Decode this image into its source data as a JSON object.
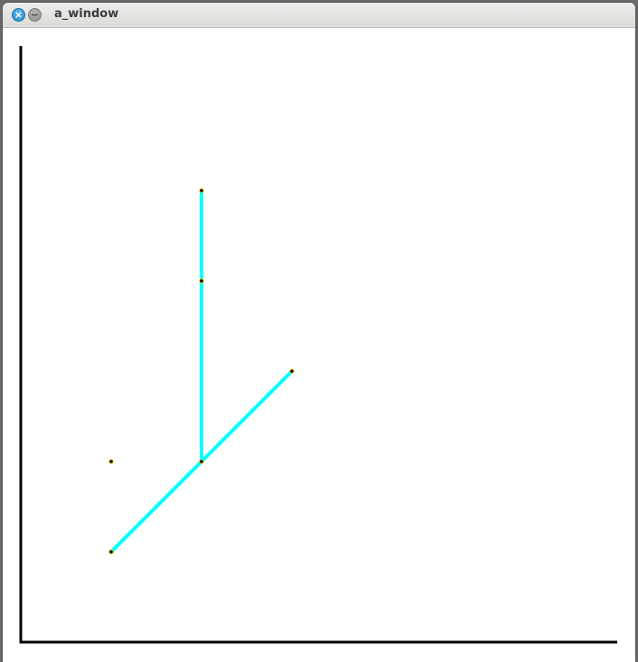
{
  "window": {
    "title": "a_window",
    "close_icon": "close-icon",
    "minimize_icon": "minimize-icon"
  },
  "plot": {
    "axis_color": "#000000",
    "line_color": "#00ffff",
    "point_color": "#000000",
    "point_halo_color": "#ffd400",
    "x_range": [
      0,
      6.6
    ],
    "y_range": [
      0,
      6.6
    ],
    "segments": [
      {
        "from": [
          2,
          5
        ],
        "to": [
          2,
          2
        ]
      },
      {
        "from": [
          1,
          1
        ],
        "to": [
          3,
          3
        ]
      }
    ],
    "points": [
      [
        2,
        5
      ],
      [
        2,
        4
      ],
      [
        3,
        3
      ],
      [
        1,
        2
      ],
      [
        2,
        2
      ],
      [
        1,
        1
      ]
    ]
  }
}
